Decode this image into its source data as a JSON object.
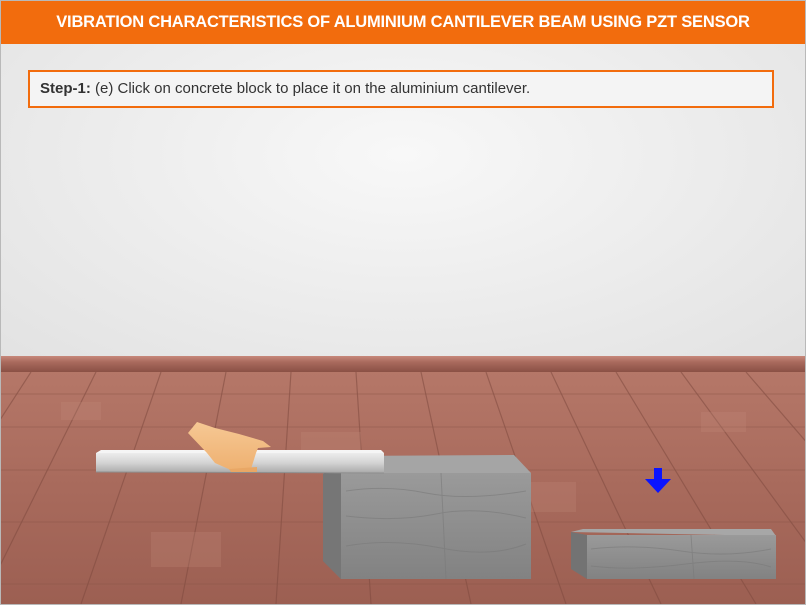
{
  "header": {
    "title": "VIBRATION CHARACTERISTICS OF ALUMINIUM CANTILEVER BEAM USING PZT SENSOR"
  },
  "instruction": {
    "step_label": "Step-1:",
    "text": " (e) Click on concrete block to place it on the aluminium cantilever."
  },
  "colors": {
    "accent": "#f26c0d",
    "arrow": "#0a14ff",
    "concrete": "#8d8d8d",
    "beam": "#d4d4d4",
    "hand": "#f3bd85"
  },
  "icons": {
    "indicator": "down-arrow-icon",
    "hand": "hand-icon"
  }
}
